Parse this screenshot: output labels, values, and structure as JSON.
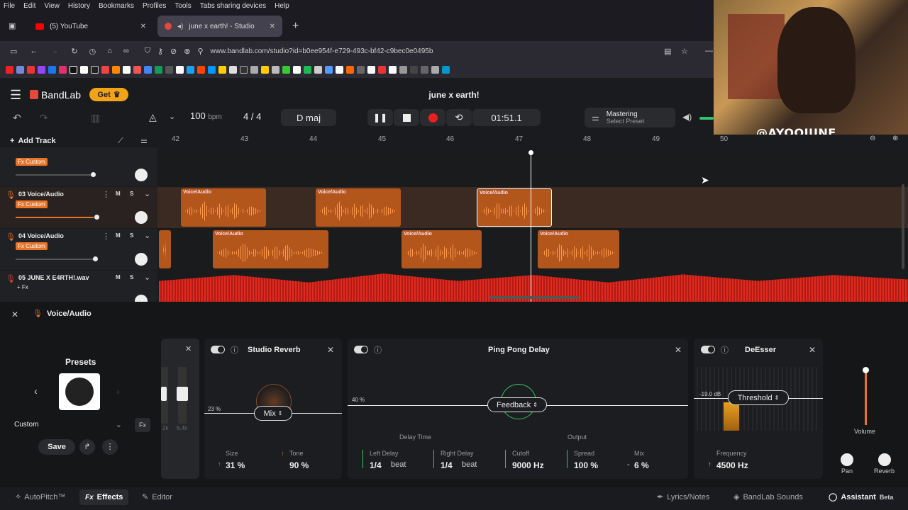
{
  "browser": {
    "menu": [
      "File",
      "Edit",
      "View",
      "History",
      "Bookmarks",
      "Profiles",
      "Tools",
      "Tabs sharing devices",
      "Help"
    ],
    "tabs": [
      {
        "label": "(5) YouTube"
      },
      {
        "label": "june x earth! - Studio"
      }
    ],
    "url": "www.bandlab.com/studio?id=b0ee954f-e729-493c-bf42-c9bec0e0495b"
  },
  "app": {
    "logo": "BandLab",
    "get_label": "Get",
    "project_title": "june x earth!",
    "bpm": "100",
    "bpm_unit": "bpm",
    "time_sig": "4 / 4",
    "key": "D maj",
    "time": "01:51.1",
    "mastering_label": "Mastering",
    "mastering_sub": "Select Preset",
    "add_track": "Add Track",
    "overlay_handle": "@AYOOJUNE"
  },
  "ruler": [
    "42",
    "43",
    "44",
    "45",
    "46",
    "47",
    "48",
    "49",
    "50"
  ],
  "tracks": [
    {
      "name": "03 Voice/Audio",
      "fx": "Fx Custom"
    },
    {
      "name": "04 Voice/Audio",
      "fx": "Fx Custom"
    },
    {
      "name": "05 JUNE X E4RTH!.wav",
      "fx": "+ Fx"
    }
  ],
  "top_track_fx": "Fx Custom",
  "clip_label": "Voice/Audio",
  "track_buttons": {
    "mute": "M",
    "solo": "S"
  },
  "panel": {
    "title": "Voice/Audio",
    "presets_title": "Presets",
    "preset_value": "Custom",
    "save_label": "Save",
    "reverb": {
      "title": "Studio Reverb",
      "mix": "Mix",
      "pct": "23 %",
      "size_label": "Size",
      "size": "31 %",
      "tone_label": "Tone",
      "tone": "90 %"
    },
    "delay": {
      "title": "Ping Pong Delay",
      "feedback": "Feedback",
      "pct": "40 %",
      "delay_time": "Delay Time",
      "output": "Output",
      "left_label": "Left Delay",
      "left": "1/4",
      "right_label": "Right Delay",
      "right": "1/4",
      "beat": "beat",
      "cutoff_label": "Cutoff",
      "cutoff": "9000 Hz",
      "spread_label": "Spread",
      "spread": "100 %",
      "mix_label": "Mix",
      "mix": "6 %"
    },
    "deesser": {
      "title": "DeEsser",
      "threshold": "Threshold",
      "db": "-19.0 dB",
      "freq_label": "Frequency",
      "freq": "4500 Hz"
    },
    "volume_label": "Volume",
    "pan_label": "Pan",
    "reverb_label": "Reverb",
    "eq_labels": [
      "2k",
      "6.4k"
    ]
  },
  "bottom": {
    "autopitch": "AutoPitch™",
    "effects": "Effects",
    "editor": "Editor",
    "lyrics": "Lyrics/Notes",
    "sounds": "BandLab Sounds",
    "assistant": "Assistant",
    "beta": "Beta"
  },
  "colors": {
    "accent": "#e8742a",
    "record": "#e82020",
    "clip": "#b3561c",
    "master": "#d0281c"
  }
}
